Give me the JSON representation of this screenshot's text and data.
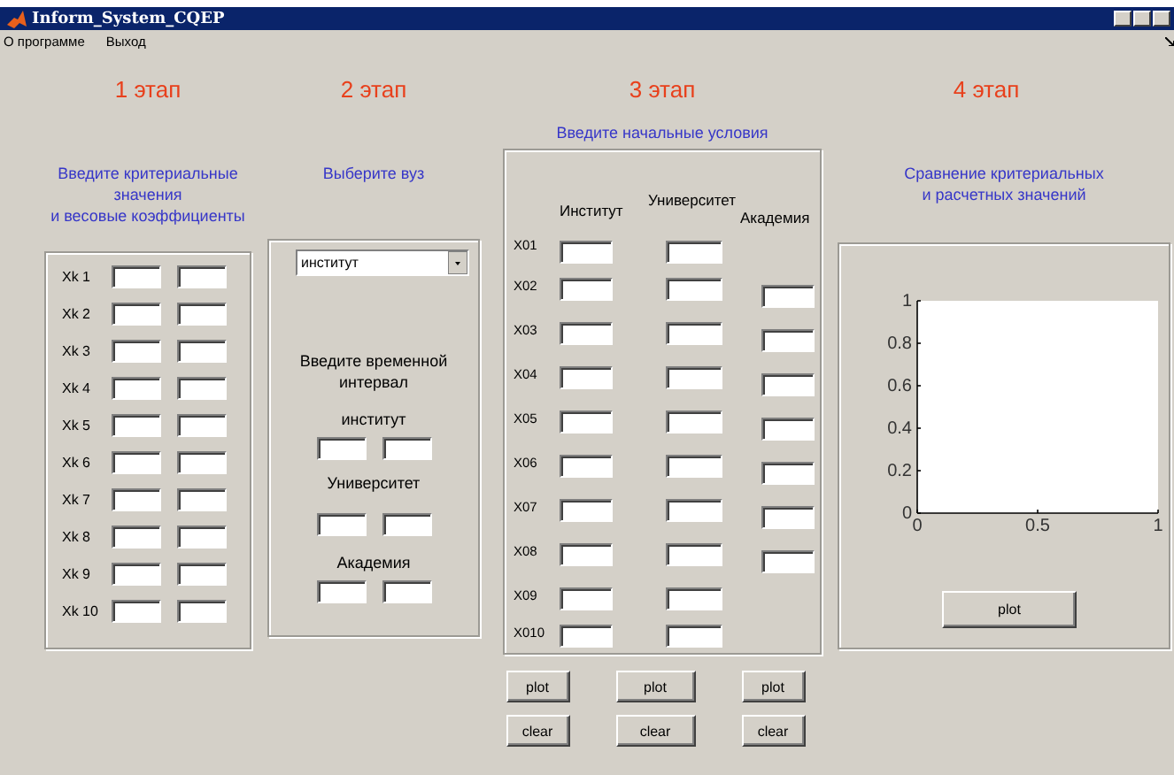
{
  "window": {
    "title": "Inform_System_CQEP"
  },
  "menu": [
    {
      "label": "О программе"
    },
    {
      "label": "Выход"
    }
  ],
  "stage_1": {
    "stage": "1 этап",
    "description": [
      "Введите критериальные",
      "значения",
      "и весовые коэффициенты"
    ],
    "rows": [
      {
        "label": "Xk 1"
      },
      {
        "label": "Xk 2"
      },
      {
        "label": "Xk 3"
      },
      {
        "label": "Xk 4"
      },
      {
        "label": "Xk 5"
      },
      {
        "label": "Xk 6"
      },
      {
        "label": "Xk 7"
      },
      {
        "label": "Xk 8"
      },
      {
        "label": "Xk 9"
      },
      {
        "label": "Xk 10"
      }
    ]
  },
  "stage_2": {
    "stage": "2 этап",
    "description": "Выберите вуз",
    "dropdown": {
      "value": "институт"
    },
    "interval_title": [
      "Введите временной",
      "интервал"
    ],
    "groups": [
      {
        "label": "институт"
      },
      {
        "label": "Университет"
      },
      {
        "label": "Академия"
      }
    ]
  },
  "stage_3": {
    "stage": "3 этап",
    "description": "Введите начальные условия",
    "headers": [
      "Институт",
      "Университет",
      "Академия"
    ],
    "rows": [
      {
        "label": "X01",
        "academy_field": false
      },
      {
        "label": "X02",
        "academy_field": true
      },
      {
        "label": "X03",
        "academy_field": true
      },
      {
        "label": "X04",
        "academy_field": true
      },
      {
        "label": "X05",
        "academy_field": true
      },
      {
        "label": "X06",
        "academy_field": true
      },
      {
        "label": "X07",
        "academy_field": true
      },
      {
        "label": "X08",
        "academy_field": true
      },
      {
        "label": "X09",
        "academy_field": false
      },
      {
        "label": "X010",
        "academy_field": false
      }
    ],
    "buttons": [
      [
        "plot",
        "clear"
      ],
      [
        "plot",
        "clear"
      ],
      [
        "plot",
        "clear"
      ]
    ]
  },
  "stage_4": {
    "stage": "4 этап",
    "description": [
      "Сравнение критериальных",
      "и расчетных значений"
    ],
    "chart_data": {
      "type": "line",
      "xlim": [
        0,
        1
      ],
      "ylim": [
        0,
        1
      ],
      "xticks": [
        0,
        0.5,
        1
      ],
      "yticks": [
        0,
        0.2,
        0.4,
        0.6,
        0.8,
        1
      ]
    },
    "button": "plot"
  }
}
